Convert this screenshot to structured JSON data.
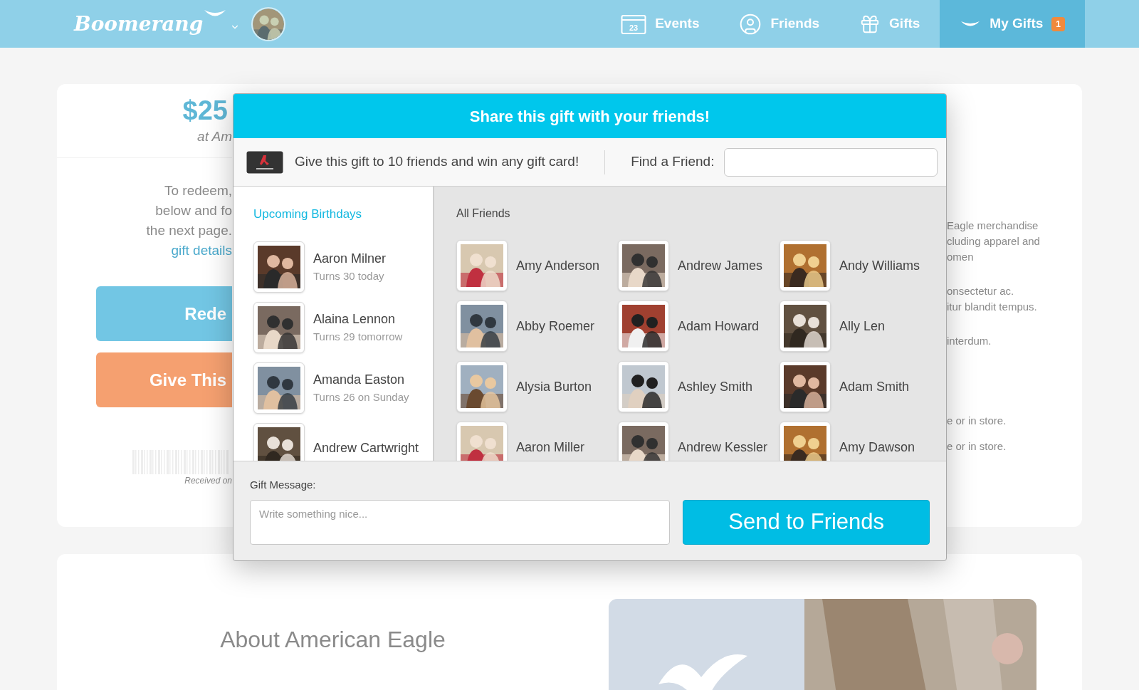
{
  "header": {
    "logo": "Boomerang",
    "nav": [
      {
        "kind": "events",
        "label": "Events",
        "icon_text": "23",
        "selected": false
      },
      {
        "kind": "friends",
        "label": "Friends",
        "selected": false
      },
      {
        "kind": "gifts",
        "label": "Gifts",
        "selected": false
      },
      {
        "kind": "mygifts",
        "label": "My Gifts",
        "badge": "1",
        "selected": true
      }
    ]
  },
  "background": {
    "gift_value": "$25",
    "gift_store": "at Am",
    "instructions": [
      "To redeem,",
      "below and fo",
      "the next page."
    ],
    "link": "gift details",
    "buttons": [
      {
        "kind": "redeem",
        "label": "Rede"
      },
      {
        "kind": "give",
        "label": "Give This"
      }
    ],
    "received": "Received on",
    "side_text": [
      "Eagle merchandise",
      "cluding apparel and",
      "omen",
      "onsectetur ac.",
      "itur blandit tempus.",
      "interdum.",
      "e or in store.",
      "e or in store."
    ],
    "about_title": "About American Eagle"
  },
  "modal": {
    "title": "Share this gift with your friends!",
    "promo": "Give this gift to 10 friends and win any gift card!",
    "find_label": "Find a Friend:",
    "birthdays_title": "Upcoming Birthdays",
    "birthdays": [
      {
        "name": "Aaron Milner",
        "note": "Turns 30 today"
      },
      {
        "name": "Alaina Lennon",
        "note": "Turns 29 tomorrow"
      },
      {
        "name": "Amanda Easton",
        "note": "Turns 26 on Sunday"
      },
      {
        "name": "Andrew Cartwright"
      }
    ],
    "friends_title": "All Friends",
    "friends": [
      "Amy Anderson",
      "Andrew James",
      "Andy Williams",
      "Abby Roemer",
      "Adam Howard",
      "Ally Len",
      "Alysia Burton",
      "Ashley Smith",
      "Adam Smith",
      "Aaron Miller",
      "Andrew Kessler",
      "Amy Dawson"
    ],
    "message_label": "Gift Message:",
    "message_placeholder": "Write something nice...",
    "send_button": "Send to Friends"
  }
}
